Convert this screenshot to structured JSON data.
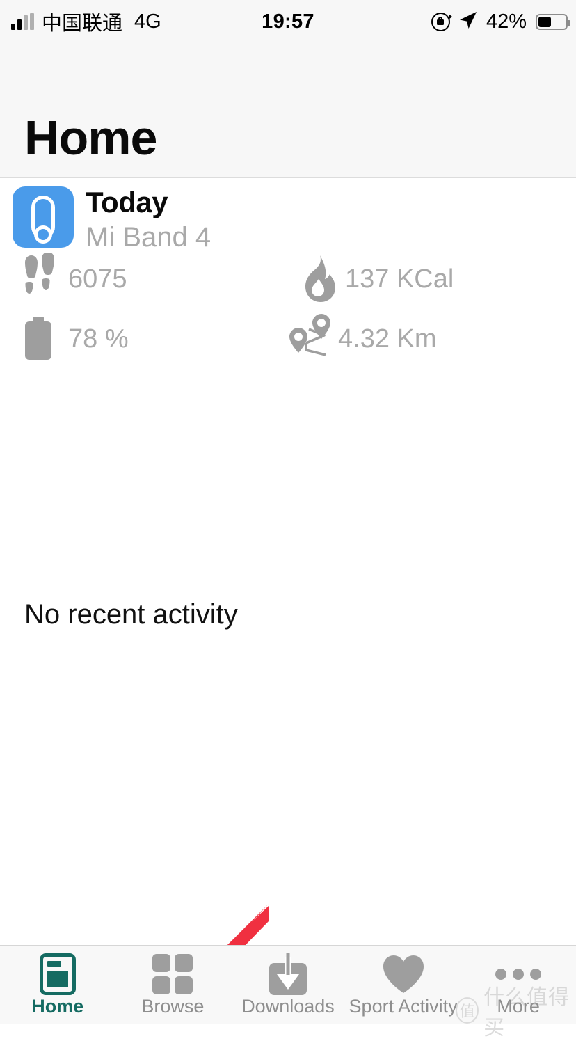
{
  "status_bar": {
    "carrier": "中国联通",
    "network": "4G",
    "time": "19:57",
    "battery_percent": "42%",
    "battery_level": 42,
    "icons": [
      "signal-bars-icon",
      "rotation-lock-icon",
      "location-arrow-icon",
      "battery-icon"
    ]
  },
  "header": {
    "title": "Home"
  },
  "device_card": {
    "icon": "mi-band-app-icon",
    "title": "Today",
    "subtitle": "Mi Band 4",
    "stats": [
      {
        "icon": "footsteps-icon",
        "value": "6075"
      },
      {
        "icon": "flame-icon",
        "value": "137 KCal"
      },
      {
        "icon": "battery-icon",
        "value": "78 %"
      },
      {
        "icon": "route-pins-icon",
        "value": "4.32 Km"
      }
    ],
    "recent_activity": "No recent activity"
  },
  "tab_bar": {
    "active_color": "#156b62",
    "inactive_color": "#8e8e8e",
    "tabs": [
      {
        "label": "Home",
        "icon": "home-icon",
        "active": true
      },
      {
        "label": "Browse",
        "icon": "grid-icon",
        "active": false
      },
      {
        "label": "Downloads",
        "icon": "download-icon",
        "active": false
      },
      {
        "label": "Sport Activity",
        "icon": "heart-icon",
        "active": false
      },
      {
        "label": "More",
        "icon": "ellipsis-icon",
        "active": false
      }
    ]
  },
  "annotation": {
    "arrow": "red-arrow-pointing-to-browse-tab",
    "arrow_color": "#f03040"
  },
  "watermark": {
    "badge": "值",
    "text": "什么值得买"
  }
}
